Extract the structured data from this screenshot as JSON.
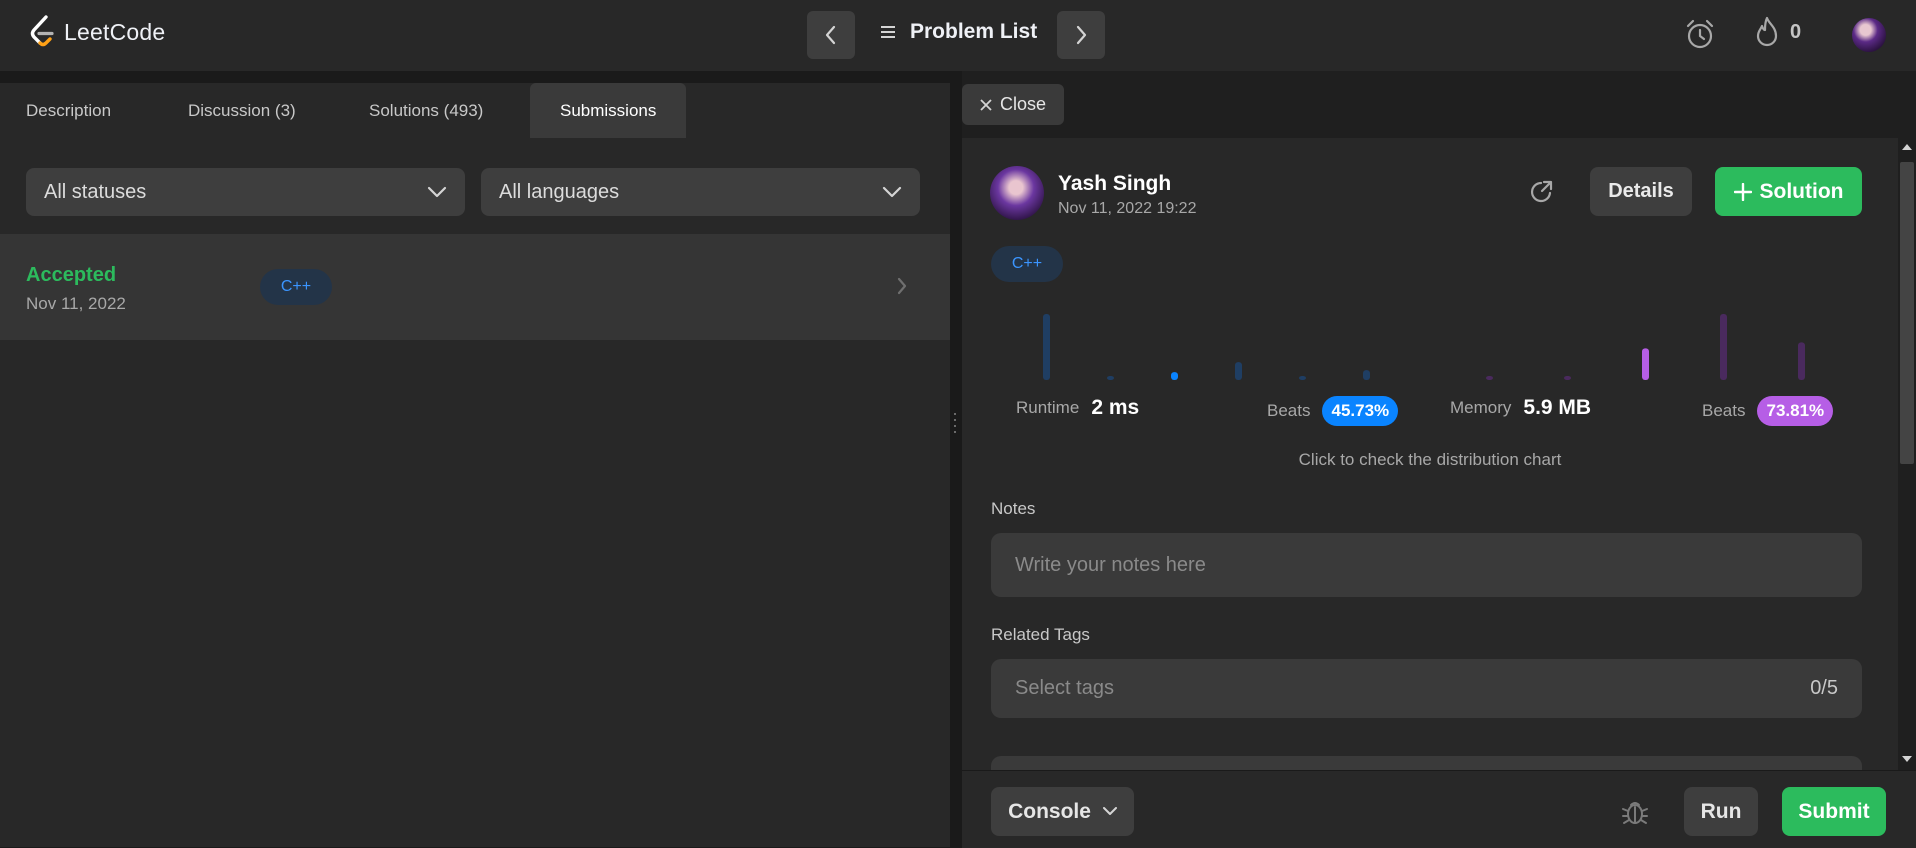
{
  "header": {
    "logo_text": "LeetCode",
    "problem_list_label": "Problem List",
    "streak_count": "0",
    "icons": [
      "prev-icon",
      "next-icon",
      "list-icon",
      "alarm-icon",
      "fire-icon"
    ]
  },
  "left_panel": {
    "tabs": [
      {
        "label": "Description"
      },
      {
        "label": "Discussion (3)"
      },
      {
        "label": "Solutions (493)"
      },
      {
        "label": "Submissions",
        "active": true
      }
    ],
    "filters": {
      "status": "All statuses",
      "language": "All languages"
    },
    "submissions": [
      {
        "status": "Accepted",
        "date": "Nov 11, 2022",
        "language": "C++"
      }
    ]
  },
  "detail": {
    "close_label": "Close",
    "user_name": "Yash Singh",
    "submitted_at": "Nov 11, 2022 19:22",
    "language": "C++",
    "details_label": "Details",
    "solution_label": "Solution",
    "runtime": {
      "label": "Runtime",
      "value": "2 ms",
      "beats_label": "Beats",
      "beats": "45.73%"
    },
    "memory": {
      "label": "Memory",
      "value": "5.9 MB",
      "beats_label": "Beats",
      "beats": "73.81%"
    },
    "distribution_hint": "Click to check the distribution chart",
    "notes_label": "Notes",
    "notes_placeholder": "Write your notes here",
    "tags_label": "Related Tags",
    "tags_placeholder": "Select tags",
    "tags_count": "0/5"
  },
  "mini_chart": {
    "runtime_bars": [
      1.0,
      0.06,
      0.12,
      0.27,
      0.06,
      0.15
    ],
    "runtime_highlight_index": 2,
    "memory_bars": [
      0.06,
      0.06,
      0.48,
      1.0,
      0.57
    ],
    "memory_highlight_index": 2
  },
  "footer": {
    "console_label": "Console",
    "run_label": "Run",
    "submit_label": "Submit"
  },
  "colors": {
    "accent_green": "#2cbb5d",
    "runtime_blue": "#0a84ff",
    "memory_purple": "#b65ee6",
    "accepted_green": "#2cbb5d"
  }
}
